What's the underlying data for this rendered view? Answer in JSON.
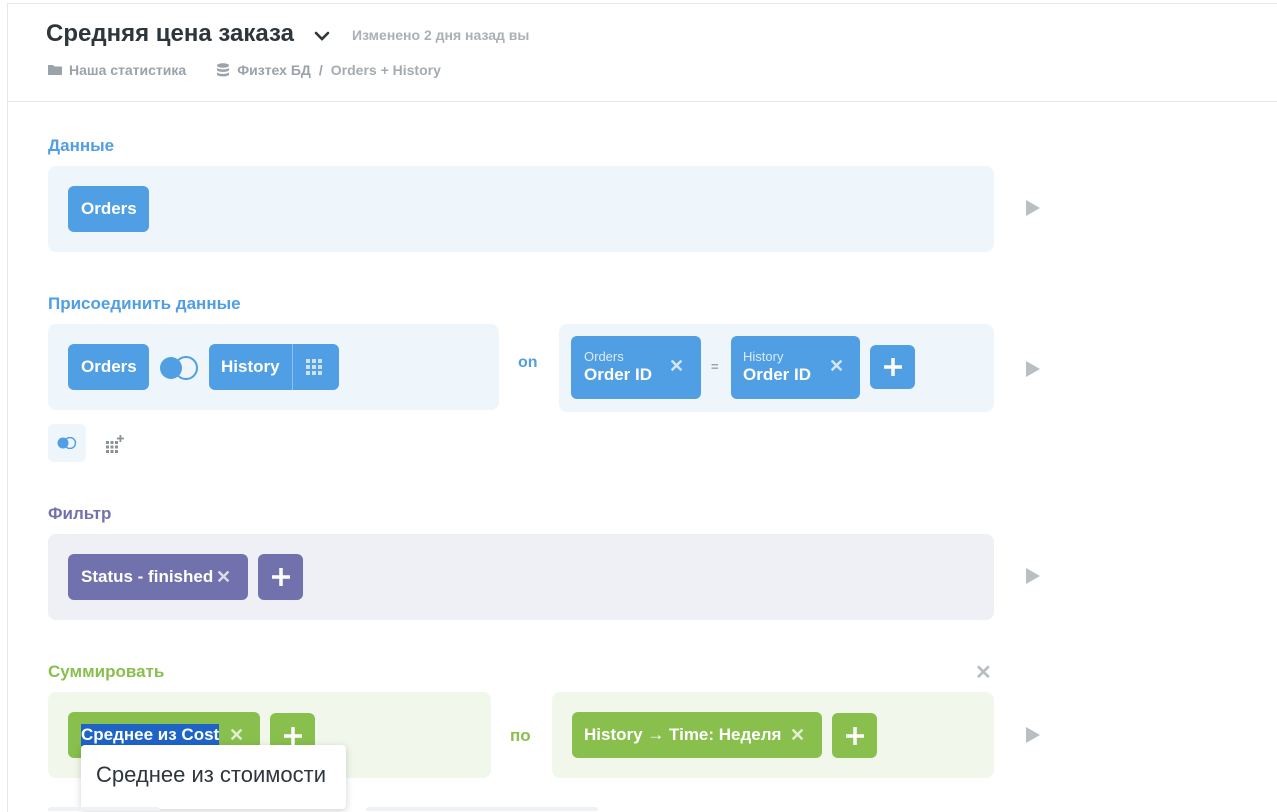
{
  "header": {
    "title": "Средняя цена заказа",
    "edited": "Изменено 2 дня назад вы",
    "breadcrumb": {
      "collection": "Наша статистика",
      "database": "Физтех БД",
      "separator": "/",
      "table": "Orders + History"
    }
  },
  "data_section": {
    "label": "Данные",
    "table": "Orders"
  },
  "join_section": {
    "label": "Присоединить данные",
    "left_table": "Orders",
    "right_table": "History",
    "on_label": "on",
    "left_key_table": "Orders",
    "left_key_field": "Order ID",
    "equals": "=",
    "right_key_table": "History",
    "right_key_field": "Order ID"
  },
  "filter_section": {
    "label": "Фильтр",
    "filter": "Status - finished"
  },
  "summarize_section": {
    "label": "Суммировать",
    "metric": "Среднее из Cost",
    "by_label": "по",
    "breakout": "History → Time: Неделя",
    "tooltip": "Среднее из стоимости"
  },
  "colors": {
    "data": "#509ee3",
    "filter": "#7172ad",
    "summarize": "#88bf4d",
    "play": "#b9bec4"
  }
}
